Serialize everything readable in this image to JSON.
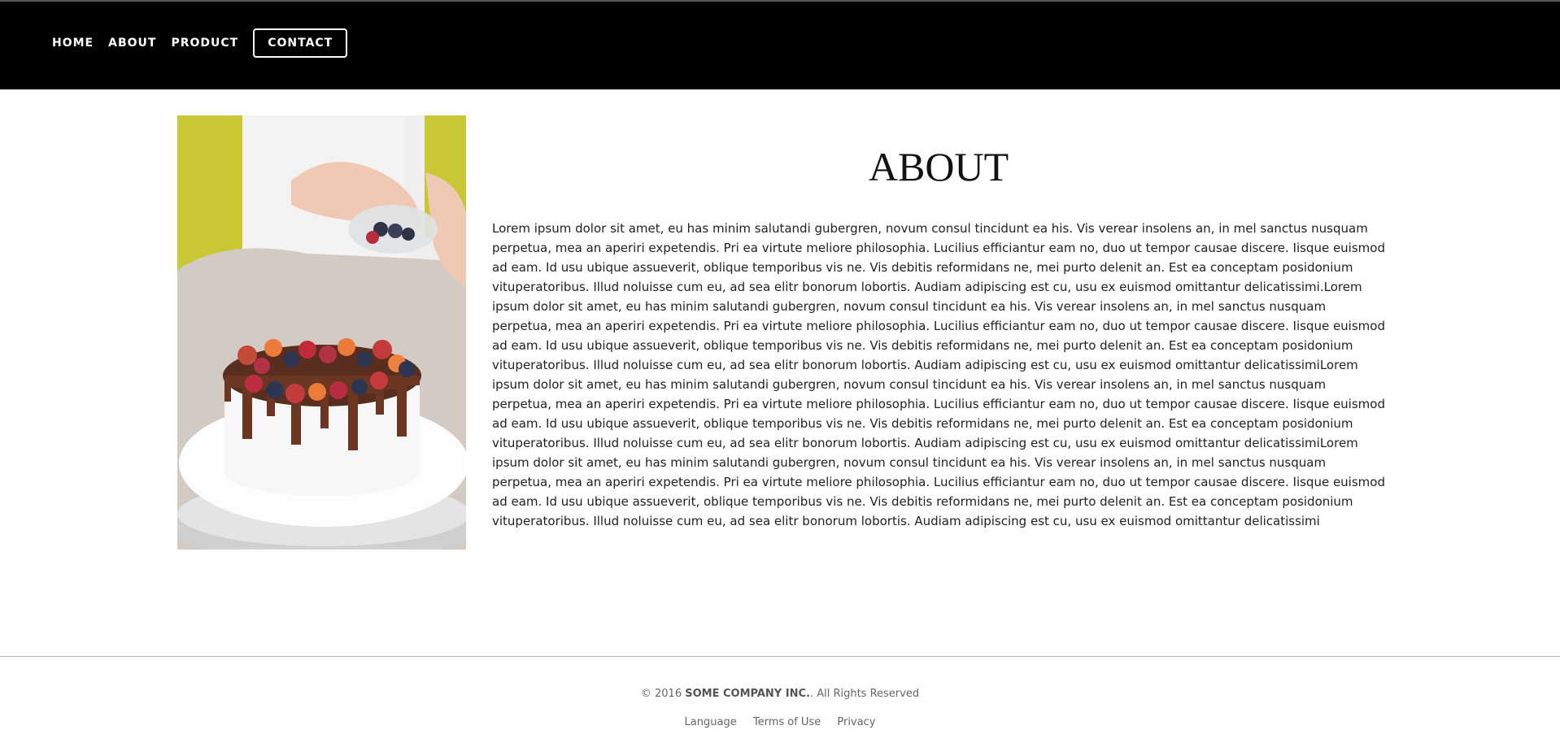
{
  "nav": {
    "items": [
      "HOME",
      "ABOUT",
      "PRODUCT"
    ],
    "contact_label": "CONTACT"
  },
  "about": {
    "title": "ABOUT",
    "body": "Lorem ipsum dolor sit amet, eu has minim salutandi gubergren, novum consul tincidunt ea his. Vis verear insolens an, in mel sanctus nusquam perpetua, mea an aperiri expetendis. Pri ea virtute meliore philosophia. Lucilius efficiantur eam no, duo ut tempor causae discere. Iisque euismod ad eam. Id usu ubique assueverit, oblique temporibus vis ne. Vis debitis reformidans ne, mei purto delenit an. Est ea conceptam posidonium vituperatoribus. Illud noluisse cum eu, ad sea elitr bonorum lobortis. Audiam adipiscing est cu, usu ex euismod omittantur delicatissimi.Lorem ipsum dolor sit amet, eu has minim salutandi gubergren, novum consul tincidunt ea his. Vis verear insolens an, in mel sanctus nusquam perpetua, mea an aperiri expetendis. Pri ea virtute meliore philosophia. Lucilius efficiantur eam no, duo ut tempor causae discere. Iisque euismod ad eam. Id usu ubique assueverit, oblique temporibus vis ne. Vis debitis reformidans ne, mei purto delenit an. Est ea conceptam posidonium vituperatoribus. Illud noluisse cum eu, ad sea elitr bonorum lobortis. Audiam adipiscing est cu, usu ex euismod omittantur delicatissimiLorem ipsum dolor sit amet, eu has minim salutandi gubergren, novum consul tincidunt ea his. Vis verear insolens an, in mel sanctus nusquam perpetua, mea an aperiri expetendis. Pri ea virtute meliore philosophia. Lucilius efficiantur eam no, duo ut tempor causae discere. Iisque euismod ad eam. Id usu ubique assueverit, oblique temporibus vis ne. Vis debitis reformidans ne, mei purto delenit an. Est ea conceptam posidonium vituperatoribus. Illud noluisse cum eu, ad sea elitr bonorum lobortis. Audiam adipiscing est cu, usu ex euismod omittantur delicatissimiLorem ipsum dolor sit amet, eu has minim salutandi gubergren, novum consul tincidunt ea his. Vis verear insolens an, in mel sanctus nusquam perpetua, mea an aperiri expetendis. Pri ea virtute meliore philosophia. Lucilius efficiantur eam no, duo ut tempor causae discere. Iisque euismod ad eam. Id usu ubique assueverit, oblique temporibus vis ne. Vis debitis reformidans ne, mei purto delenit an. Est ea conceptam posidonium vituperatoribus. Illud noluisse cum eu, ad sea elitr bonorum lobortis. Audiam adipiscing est cu, usu ex euismod omittantur delicatissimi"
  },
  "footer": {
    "copyright_prefix": "© 2016",
    "company": "SOME COMPANY INC.",
    "copyright_suffix": ". All Rights Reserved",
    "links": [
      "Language",
      "Terms of Use",
      "Privacy"
    ]
  }
}
